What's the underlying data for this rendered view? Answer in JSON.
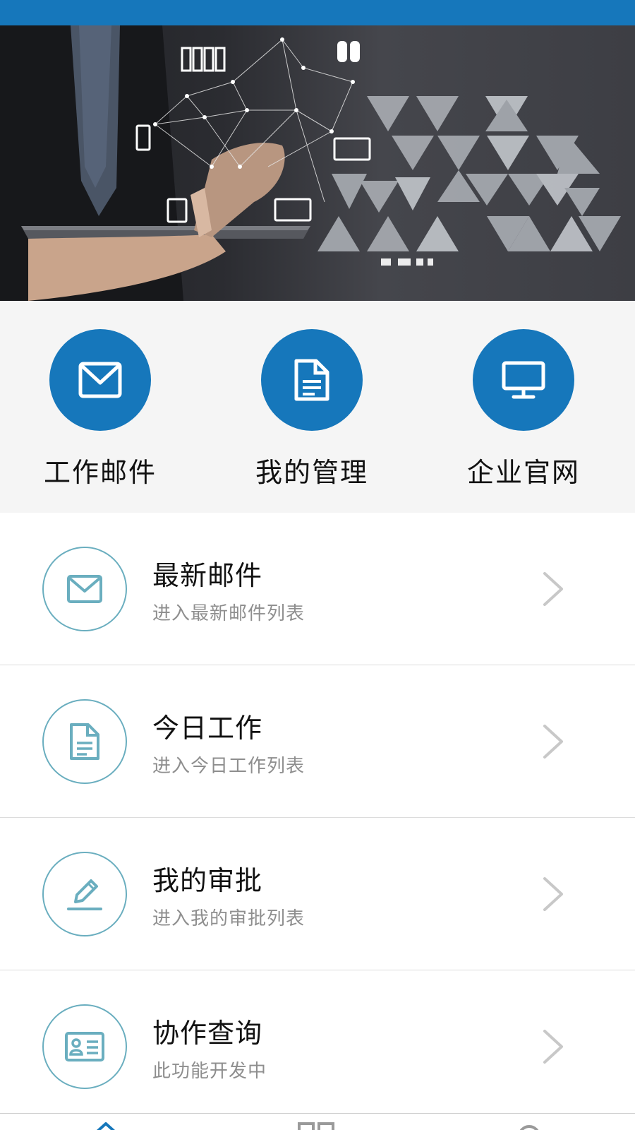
{
  "quick_actions": [
    {
      "label": "工作邮件",
      "icon": "mail-icon"
    },
    {
      "label": "我的管理",
      "icon": "document-icon"
    },
    {
      "label": "企业官网",
      "icon": "monitor-icon"
    }
  ],
  "list_items": [
    {
      "title": "最新邮件",
      "subtitle": "进入最新邮件列表",
      "icon": "mail-icon"
    },
    {
      "title": "今日工作",
      "subtitle": "进入今日工作列表",
      "icon": "document-icon"
    },
    {
      "title": "我的审批",
      "subtitle": "进入我的审批列表",
      "icon": "pencil-icon"
    },
    {
      "title": "协作查询",
      "subtitle": "此功能开发中",
      "icon": "id-card-icon"
    }
  ],
  "tab_bar": {
    "tabs": [
      {
        "icon": "home-icon",
        "active": true
      },
      {
        "icon": "grid-icon",
        "active": false
      },
      {
        "icon": "search-icon",
        "active": false
      }
    ]
  },
  "colors": {
    "primary": "#1677bb",
    "quick_section_bg": "#f5f5f5",
    "list_icon_border": "#6aaebf",
    "subtitle": "#8e8e8e",
    "chevron": "#c8c8c8",
    "tab_active": "#1677bb",
    "tab_inactive": "#9a9a9a"
  }
}
